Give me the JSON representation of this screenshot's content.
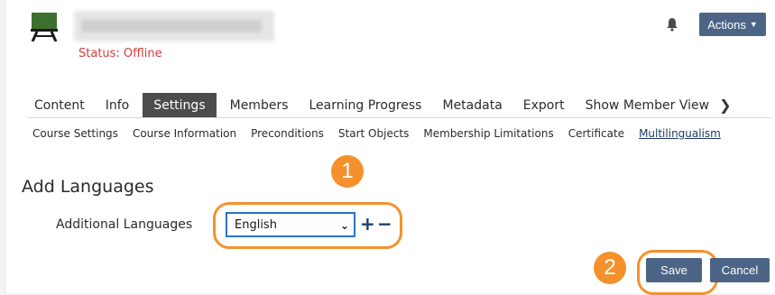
{
  "header": {
    "status_text": "Status: Offline",
    "actions_label": "Actions",
    "avatar_icon": "blackboard-icon",
    "bell_icon": "bell-icon"
  },
  "tabs": [
    {
      "label": "Content"
    },
    {
      "label": "Info"
    },
    {
      "label": "Settings",
      "active": true
    },
    {
      "label": "Members"
    },
    {
      "label": "Learning Progress"
    },
    {
      "label": "Metadata"
    },
    {
      "label": "Export"
    },
    {
      "label": "Show Member View"
    }
  ],
  "subtabs": [
    {
      "label": "Course Settings"
    },
    {
      "label": "Course Information"
    },
    {
      "label": "Preconditions"
    },
    {
      "label": "Start Objects"
    },
    {
      "label": "Membership Limitations"
    },
    {
      "label": "Certificate"
    },
    {
      "label": "Multilingualism",
      "active": true
    }
  ],
  "form": {
    "section_title": "Add Languages",
    "field_label": "Additional Languages",
    "selected_language": "English",
    "add_symbol": "+",
    "remove_symbol": "−"
  },
  "annotations": {
    "badge1": "1",
    "badge2": "2",
    "highlight_color": "#f5912c"
  },
  "buttons": {
    "save_label": "Save",
    "cancel_label": "Cancel"
  },
  "colors": {
    "primary": "#4c6586",
    "status_red": "#d33b3b",
    "select_border": "#2a73c9"
  }
}
